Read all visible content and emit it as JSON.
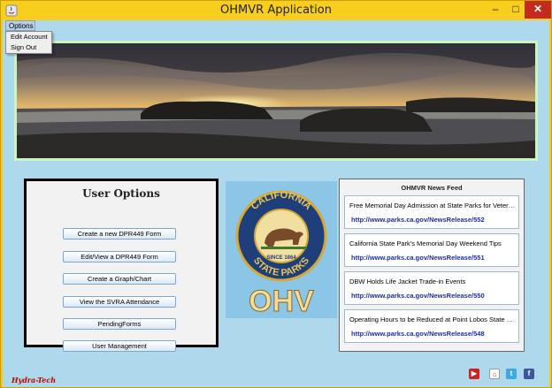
{
  "window": {
    "title": "OHMVR Application",
    "minimize_glyph": "–",
    "maximize_glyph": "□",
    "close_glyph": "✕"
  },
  "menu": {
    "options_label": "Options",
    "items": [
      {
        "label": "Edit Account"
      },
      {
        "label": "Sign Out"
      }
    ]
  },
  "user_options": {
    "title": "User Options",
    "buttons": [
      {
        "label": "Create a new DPR449 Form"
      },
      {
        "label": "Edit/View a DPR449 Form"
      },
      {
        "label": "Create a Graph/Chart"
      },
      {
        "label": "View the SVRA Attendance"
      },
      {
        "label": "PendingForms"
      },
      {
        "label": "User Management"
      }
    ]
  },
  "logo": {
    "top_text": "CALIFORNIA",
    "bottom_text": "STATE PARKS",
    "since": "SINCE 1864",
    "brand": "OHV"
  },
  "news_feed": {
    "title": "OHMVR News Feed",
    "items": [
      {
        "headline": "Free Memorial Day Admission at State Parks for Veterans",
        "link": "http://www.parks.ca.gov/NewsRelease/552"
      },
      {
        "headline": "California State Park's Memorial Day Weekend Tips",
        "link": "http://www.parks.ca.gov/NewsRelease/551"
      },
      {
        "headline": "DBW Holds Life Jacket Trade-in Events",
        "link": "http://www.parks.ca.gov/NewsRelease/550"
      },
      {
        "headline": "Operating Hours to be Reduced at Point Lobos State Natural Reserve",
        "link": "http://www.parks.ca.gov/NewsRelease/548"
      }
    ]
  },
  "footer": {
    "brand": "Hydra-Tech",
    "social_icons": [
      "youtube-icon",
      "home-icon",
      "twitter-icon",
      "facebook-icon"
    ]
  },
  "colors": {
    "title_bar": "#f7ce1e",
    "client_bg": "#aed9ec",
    "banner_border": "#7ee87b",
    "link": "#1a2da8",
    "close_button": "#c42b1c"
  }
}
